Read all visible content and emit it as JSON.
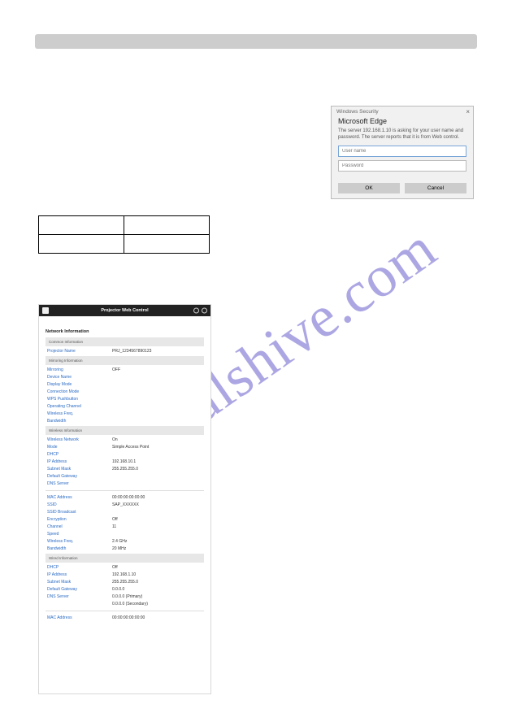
{
  "watermark": "manualshive.com",
  "dialog": {
    "titlebar": "Windows Security",
    "close": "×",
    "app": "Microsoft Edge",
    "message": "The server 192.168.1.10 is asking for your user name and password. The server reports that it is from Web control.",
    "username_placeholder": "User name",
    "password_placeholder": "Password",
    "ok": "OK",
    "cancel": "Cancel"
  },
  "panel": {
    "header_title": "Projector Web Control",
    "main_title": "Network Information",
    "groups": {
      "common": {
        "title": "Common Information",
        "projector_name_label": "Projector Name",
        "projector_name_value": "PRJ_1234567890123"
      },
      "mirroring": {
        "title": "Mirroring Information",
        "rows": [
          {
            "label": "Mirroring",
            "value": "OFF"
          },
          {
            "label": "Device Name",
            "value": ""
          },
          {
            "label": "Display Mode",
            "value": ""
          },
          {
            "label": "Connection Mode",
            "value": ""
          },
          {
            "label": "WPS Pushbutton",
            "value": ""
          },
          {
            "label": "Operating Channel",
            "value": ""
          },
          {
            "label": "Wireless Freq.",
            "value": ""
          },
          {
            "label": "Bandwidth",
            "value": ""
          }
        ]
      },
      "wireless": {
        "title": "Wireless Information",
        "rows": [
          {
            "label": "Wireless Network",
            "value": "On"
          },
          {
            "label": "Mode",
            "value": "Simple Access Point"
          },
          {
            "label": "DHCP",
            "value": ""
          },
          {
            "label": "IP Address",
            "value": "192.168.10.1"
          },
          {
            "label": "Subnet Mask",
            "value": "255.255.255.0"
          },
          {
            "label": "Default Gateway",
            "value": ""
          },
          {
            "label": "DNS Server",
            "value": ""
          }
        ],
        "rows2": [
          {
            "label": "MAC Address",
            "value": "00:00:00:00:00:00"
          },
          {
            "label": "SSID",
            "value": "SAP_XXXXXX"
          },
          {
            "label": "SSID Broadcast",
            "value": ""
          },
          {
            "label": "Encryption",
            "value": "Off"
          },
          {
            "label": "Channel",
            "value": "11"
          },
          {
            "label": "Speed",
            "value": ""
          },
          {
            "label": "Wireless Freq.",
            "value": "2.4 GHz"
          },
          {
            "label": "Bandwidth",
            "value": "20 MHz"
          }
        ]
      },
      "wired": {
        "title": "Wired Information",
        "rows": [
          {
            "label": "DHCP",
            "value": "Off"
          },
          {
            "label": "IP Address",
            "value": "192.168.1.10"
          },
          {
            "label": "Subnet Mask",
            "value": "255.255.255.0"
          },
          {
            "label": "Default Gateway",
            "value": "0.0.0.0"
          },
          {
            "label": "DNS Server",
            "value": "0.0.0.0  (Primary)"
          },
          {
            "label": "",
            "value": "0.0.0.0  (Secondary)"
          }
        ],
        "rows2": [
          {
            "label": "MAC Address",
            "value": "00:00:00:00:00:00"
          }
        ]
      }
    }
  }
}
